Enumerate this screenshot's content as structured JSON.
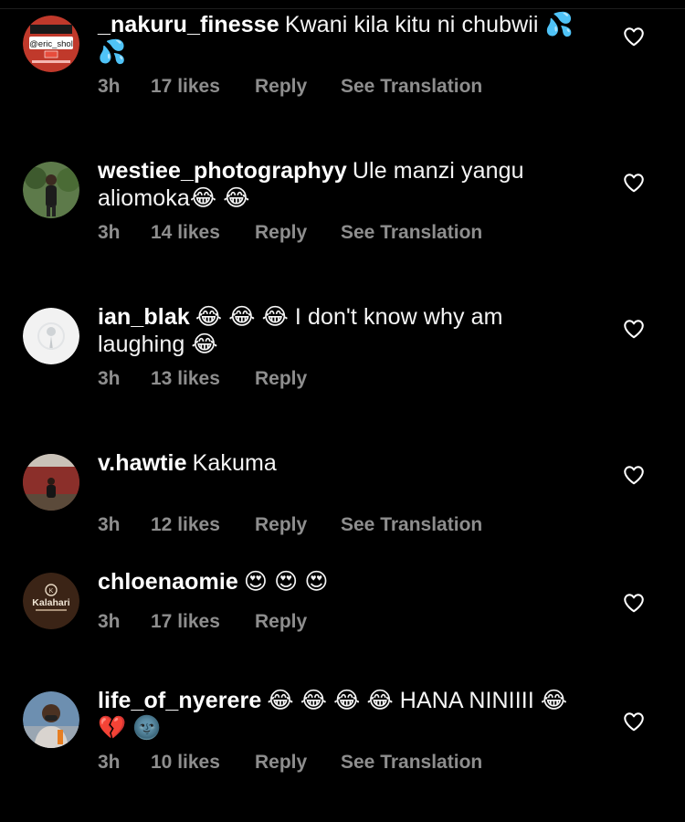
{
  "comments": [
    {
      "username": "_nakuru_finesse",
      "text": "Kwani kila kitu ni chubwii 💦 💦",
      "time": "3h",
      "likes": "17 likes",
      "reply": "Reply",
      "translate": "See Translation",
      "avatar_text": "@eric_shol"
    },
    {
      "username": "westiee_photographyy",
      "text": "Ule manzi yangu aliomoka😂 😂",
      "time": "3h",
      "likes": "14 likes",
      "reply": "Reply",
      "translate": "See Translation"
    },
    {
      "username": "ian_blak",
      "text": "😂 😂 😂 I don't know why am laughing 😂",
      "time": "3h",
      "likes": "13 likes",
      "reply": "Reply",
      "translate": ""
    },
    {
      "username": "v.hawtie",
      "text": "Kakuma",
      "time": "3h",
      "likes": "12 likes",
      "reply": "Reply",
      "translate": "See Translation"
    },
    {
      "username": "chloenaomie",
      "text": "😍 😍 😍",
      "time": "3h",
      "likes": "17 likes",
      "reply": "Reply",
      "translate": "",
      "avatar_text": "Kalahari"
    },
    {
      "username": "life_of_nyerere",
      "text": "😂 😂 😂 😂 HANA NINIIII 😂 💔 🌚",
      "time": "3h",
      "likes": "10 likes",
      "reply": "Reply",
      "translate": "See Translation"
    }
  ],
  "colors": {
    "background": "#000000",
    "text": "#ffffff",
    "muted": "#8e8e8e"
  }
}
